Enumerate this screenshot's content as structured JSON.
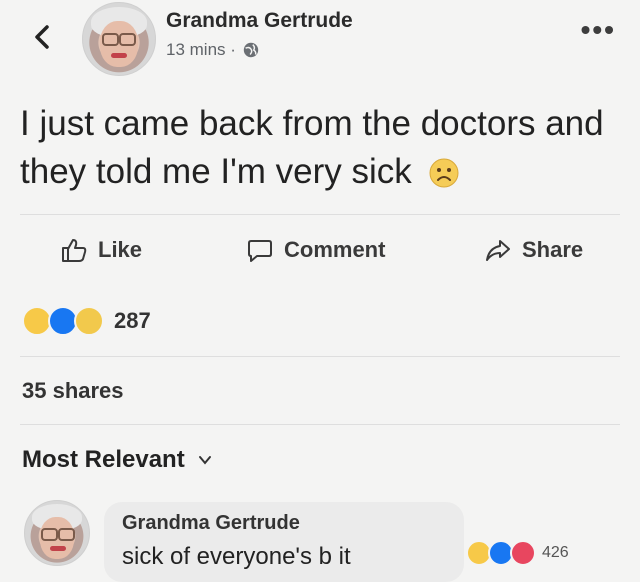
{
  "post": {
    "author": "Grandma Gertrude",
    "time": "13 mins ·",
    "text": "I just came back from the doctors and they told me I'm very sick",
    "more_label": "•••"
  },
  "actions": {
    "like": "Like",
    "comment": "Comment",
    "share": "Share"
  },
  "stats": {
    "reactions_count": "287",
    "shares": "35 shares"
  },
  "comments_sort": "Most Relevant",
  "comment": {
    "author": "Grandma Gertrude",
    "text": "sick of everyone's b      it",
    "reactions_count": "426"
  },
  "icons": {
    "back": "chevron-left-icon",
    "privacy": "globe-icon",
    "more": "more-dots-icon",
    "like": "thumbs-up-icon",
    "comment": "speech-bubble-icon",
    "share": "share-arrow-icon",
    "sort": "chevron-down-icon"
  },
  "colors": {
    "background": "#f4f4f3",
    "haha": "#f7c948",
    "like": "#1877f2",
    "love": "#e8465f",
    "sad": "#f2c94c"
  }
}
